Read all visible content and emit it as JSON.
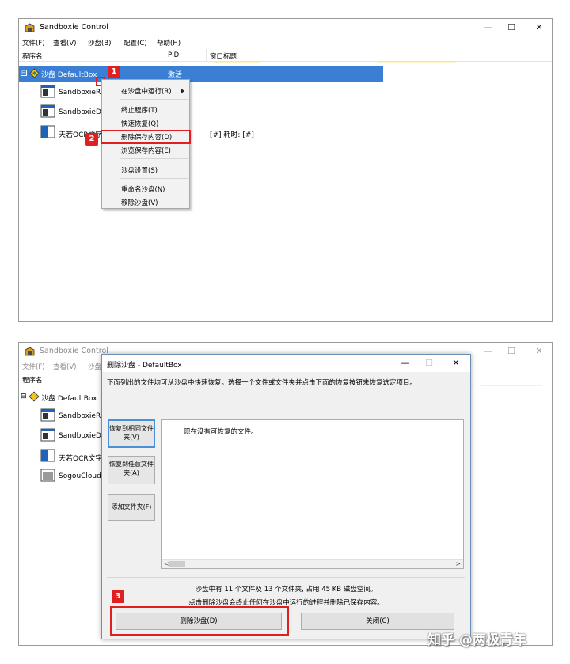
{
  "colors": {
    "accent": "#3b7fd4",
    "highlight_red": "#e02020",
    "wallpaper_yellow": "#fbf5c6"
  },
  "window": {
    "title": "Sandboxie Control",
    "controls": {
      "minimize": "—",
      "maximize": "☐",
      "close": "✕"
    },
    "menus": [
      "文件(F)",
      "查看(V)",
      "沙盘(B)",
      "配置(C)",
      "帮助(H)"
    ],
    "menus_partial": [
      "文件(F)",
      "查看(V)",
      "沙盘"
    ],
    "columns": {
      "name": "程序名",
      "pid": "PID",
      "window_title": "窗口标题"
    }
  },
  "top_panel": {
    "box": {
      "expander": "⊟",
      "name": "沙盘 DefaultBox",
      "state": "激活"
    },
    "processes": [
      "SandboxieR",
      "SandboxieD",
      "天若OCR文字"
    ],
    "ocr_row_extra": "[#] 耗时: [#]",
    "context_menu": {
      "items": [
        "在沙盘中运行(R)",
        "终止程序(T)",
        "快速恢复(Q)",
        "删除保存内容(D)",
        "浏览保存内容(E)",
        "沙盘设置(S)",
        "重命名沙盘(N)",
        "移除沙盘(V)"
      ],
      "submenu_arrow": "►"
    },
    "badges": [
      "1",
      "2"
    ]
  },
  "bottom_panel": {
    "app_title": "Sandboxie Control",
    "box": {
      "expander": "⊟",
      "name": "沙盘 DefaultBox"
    },
    "processes": [
      "SandboxieR",
      "SandboxieD",
      "天若OCR文字",
      "SogouCloud"
    ],
    "dialog": {
      "title": "删除沙盘 - DefaultBox",
      "instruction": "下面列出的文件均可从沙盘中快速恢复。选择一个文件或文件夹并点击下面的恢复按钮来恢复选定项目。",
      "side_buttons": [
        "恢复到相同文件夹(V)",
        "恢复到任意文件夹(A)",
        "添加文件夹(F)"
      ],
      "list_empty": "现在没有可恢复的文件。",
      "info_line1": "沙盘中有 11 个文件及 13 个文件夹, 占用 45 KB 磁盘空间。",
      "info_line2": "点击删除沙盘会终止任何在沙盘中运行的进程并删除已保存内容。",
      "delete_button": "删除沙盘(D)",
      "close_button": "关闭(C)",
      "scroll_left": "<",
      "scroll_right": ">"
    },
    "badge": "3"
  },
  "watermark": "知乎 @两极青年"
}
